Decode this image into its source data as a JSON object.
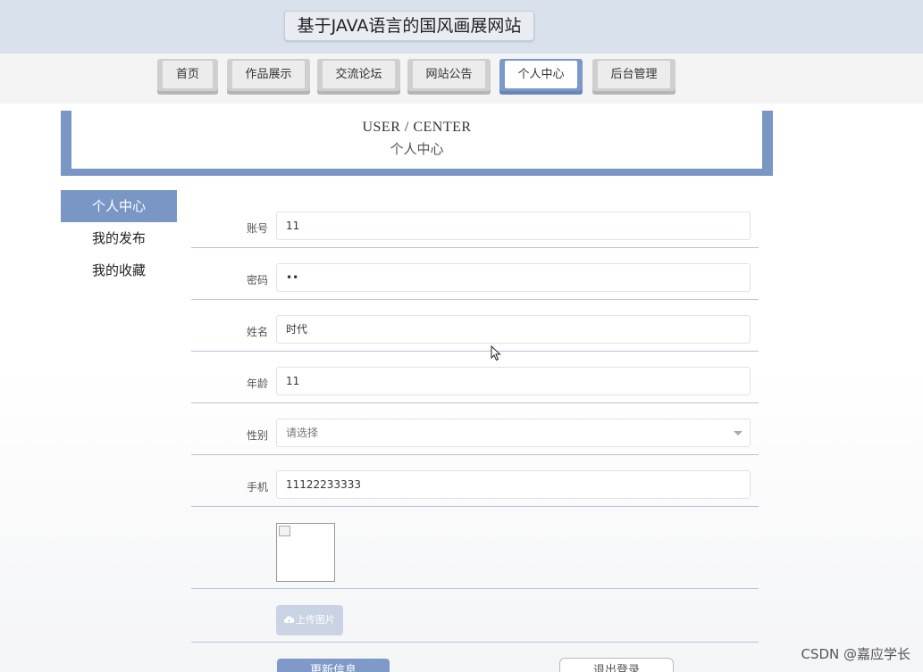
{
  "header": {
    "title": "基于JAVA语言的国风画展网站"
  },
  "nav": {
    "items": [
      {
        "label": "首页"
      },
      {
        "label": "作品展示"
      },
      {
        "label": "交流论坛"
      },
      {
        "label": "网站公告"
      },
      {
        "label": "个人中心",
        "active": true
      },
      {
        "label": "后台管理"
      }
    ]
  },
  "banner": {
    "title_en": "USER / CENTER",
    "title_zh": "个人中心"
  },
  "sidebar": {
    "items": [
      {
        "label": "个人中心",
        "active": true
      },
      {
        "label": "我的发布"
      },
      {
        "label": "我的收藏"
      }
    ]
  },
  "form": {
    "account": {
      "label": "账号",
      "value": "11"
    },
    "password": {
      "label": "密码",
      "value": "••"
    },
    "name": {
      "label": "姓名",
      "value": "时代"
    },
    "age": {
      "label": "年龄",
      "value": "11"
    },
    "gender": {
      "label": "性别",
      "placeholder": "请选择"
    },
    "phone": {
      "label": "手机",
      "value": "11122233333"
    },
    "upload_label": "上传图片",
    "update_label": "更新信息",
    "logout_label": "退出登录"
  },
  "watermark": "CSDN @嘉应学长",
  "colors": {
    "accent": "#7996c5",
    "topbar": "#d9e1ec"
  },
  "icons": {
    "upload": "cloud-upload-icon",
    "cursor": "mouse-pointer-icon"
  }
}
